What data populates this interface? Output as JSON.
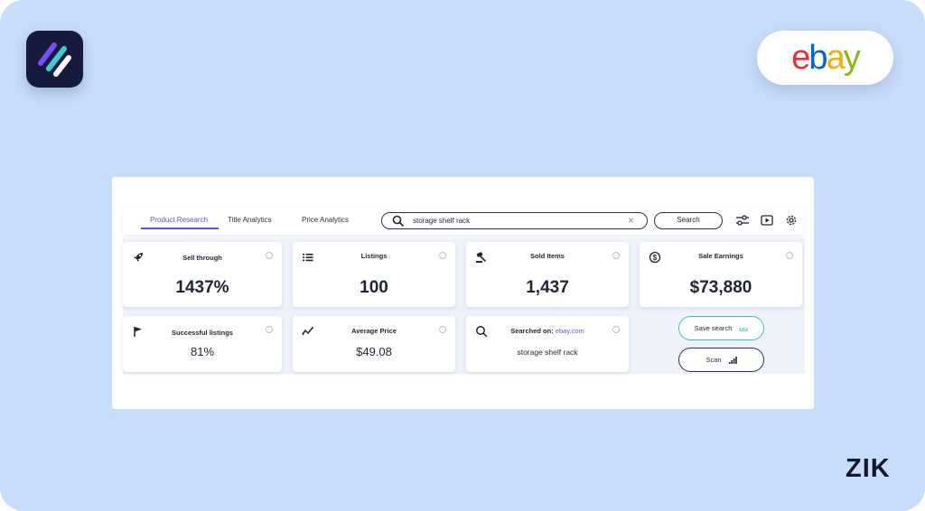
{
  "brand": {
    "ebay_letters": [
      "e",
      "b",
      "a",
      "y"
    ],
    "footer_logo": "ZIK"
  },
  "toolbar": {
    "tabs": [
      {
        "label": "Product Research",
        "active": true
      },
      {
        "label": "Title Analytics",
        "active": false
      },
      {
        "label": "Price Analytics",
        "active": false
      }
    ],
    "search_value": "storage shelf rack",
    "search_button": "Search",
    "icons": [
      "search-icon",
      "clear-icon",
      "filter-sliders-icon",
      "video-play-icon",
      "gear-icon"
    ]
  },
  "stats": {
    "sell_through": {
      "title": "Sell through",
      "value": "1437%",
      "icon": "rocket-icon"
    },
    "listings": {
      "title": "Listings",
      "value": "100",
      "icon": "list-icon"
    },
    "sold_items": {
      "title": "Sold Items",
      "value": "1,437",
      "icon": "gavel-icon"
    },
    "sale_earnings": {
      "title": "Sale Earnings",
      "value": "$73,880",
      "icon": "dollar-coin-icon"
    },
    "successful_listings": {
      "title": "Successful listings",
      "value": "81%",
      "icon": "flag-icon"
    },
    "average_price": {
      "title": "Average Price",
      "value": "$49.08",
      "icon": "trend-icon"
    },
    "searched_on": {
      "title": "Searched on:",
      "site": "ebay.com",
      "query": "storage shelf rack",
      "icon": "search-icon"
    }
  },
  "actions": {
    "save_search": "Save search",
    "scan": "Scan"
  },
  "colors": {
    "background": "#c8ddfb",
    "accent": "#6a4fd6",
    "save_border": "#37c4b6"
  }
}
